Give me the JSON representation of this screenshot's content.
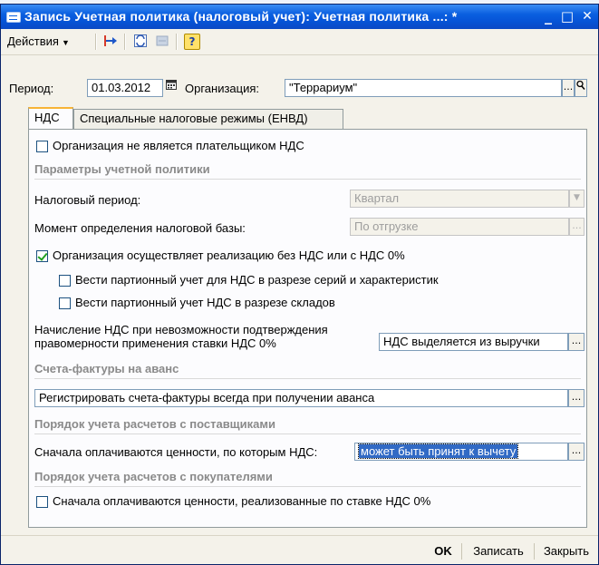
{
  "window": {
    "title": "Запись Учетная политика (налоговый учет): Учетная политика ...: *",
    "controls": {
      "minimize": "_",
      "maximize": "□",
      "close": "✕"
    }
  },
  "toolbar": {
    "actions_label": "Действия",
    "icons": [
      "insert-icon",
      "refresh-icon",
      "disabled-icon",
      "help-icon"
    ],
    "help_label": "?"
  },
  "header": {
    "period_label": "Период:",
    "period_value": "01.03.2012",
    "organization_label": "Организация:",
    "organization_value": "\"Террариум\"",
    "select_button": "..."
  },
  "tabs": [
    {
      "label": "НДС",
      "active": true
    },
    {
      "label": "Специальные налоговые режимы (ЕНВД)",
      "active": false
    }
  ],
  "nds": {
    "not_payer_label": "Организация не является плательщиком НДС",
    "params_section": "Параметры учетной политики",
    "tax_period_label": "Налоговый период:",
    "tax_period_value": "Квартал",
    "tax_base_moment_label": "Момент определения налоговой базы:",
    "tax_base_moment_value": "По отгрузке",
    "zero_rate_label": "Организация осуществляет реализацию без НДС или с НДС 0%",
    "zero_rate_checked": true,
    "batch_series_label": "Вести партионный учет для НДС в разрезе серий и характеристик",
    "batch_warehouse_label": "Вести партионный учет НДС в разрезе складов",
    "charge_label_line1": "Начисление НДС при невозможности подтверждения",
    "charge_label_line2": "правомерности применения ставки НДС 0%",
    "charge_value": "НДС выделяется из выручки",
    "invoices_section": "Счета-фактуры на аванс",
    "invoices_value": "Регистрировать счета-фактуры всегда при получении аванса",
    "suppliers_section": "Порядок учета расчетов с поставщиками",
    "suppliers_label": "Сначала оплачиваются ценности, по которым НДС:",
    "suppliers_value": "может быть принят к вычету",
    "buyers_section": "Порядок учета расчетов с покупателями",
    "buyers_label": "Сначала оплачиваются ценности, реализованные по ставке НДС 0%"
  },
  "footer": {
    "ok": "OK",
    "save": "Записать",
    "close": "Закрыть"
  }
}
